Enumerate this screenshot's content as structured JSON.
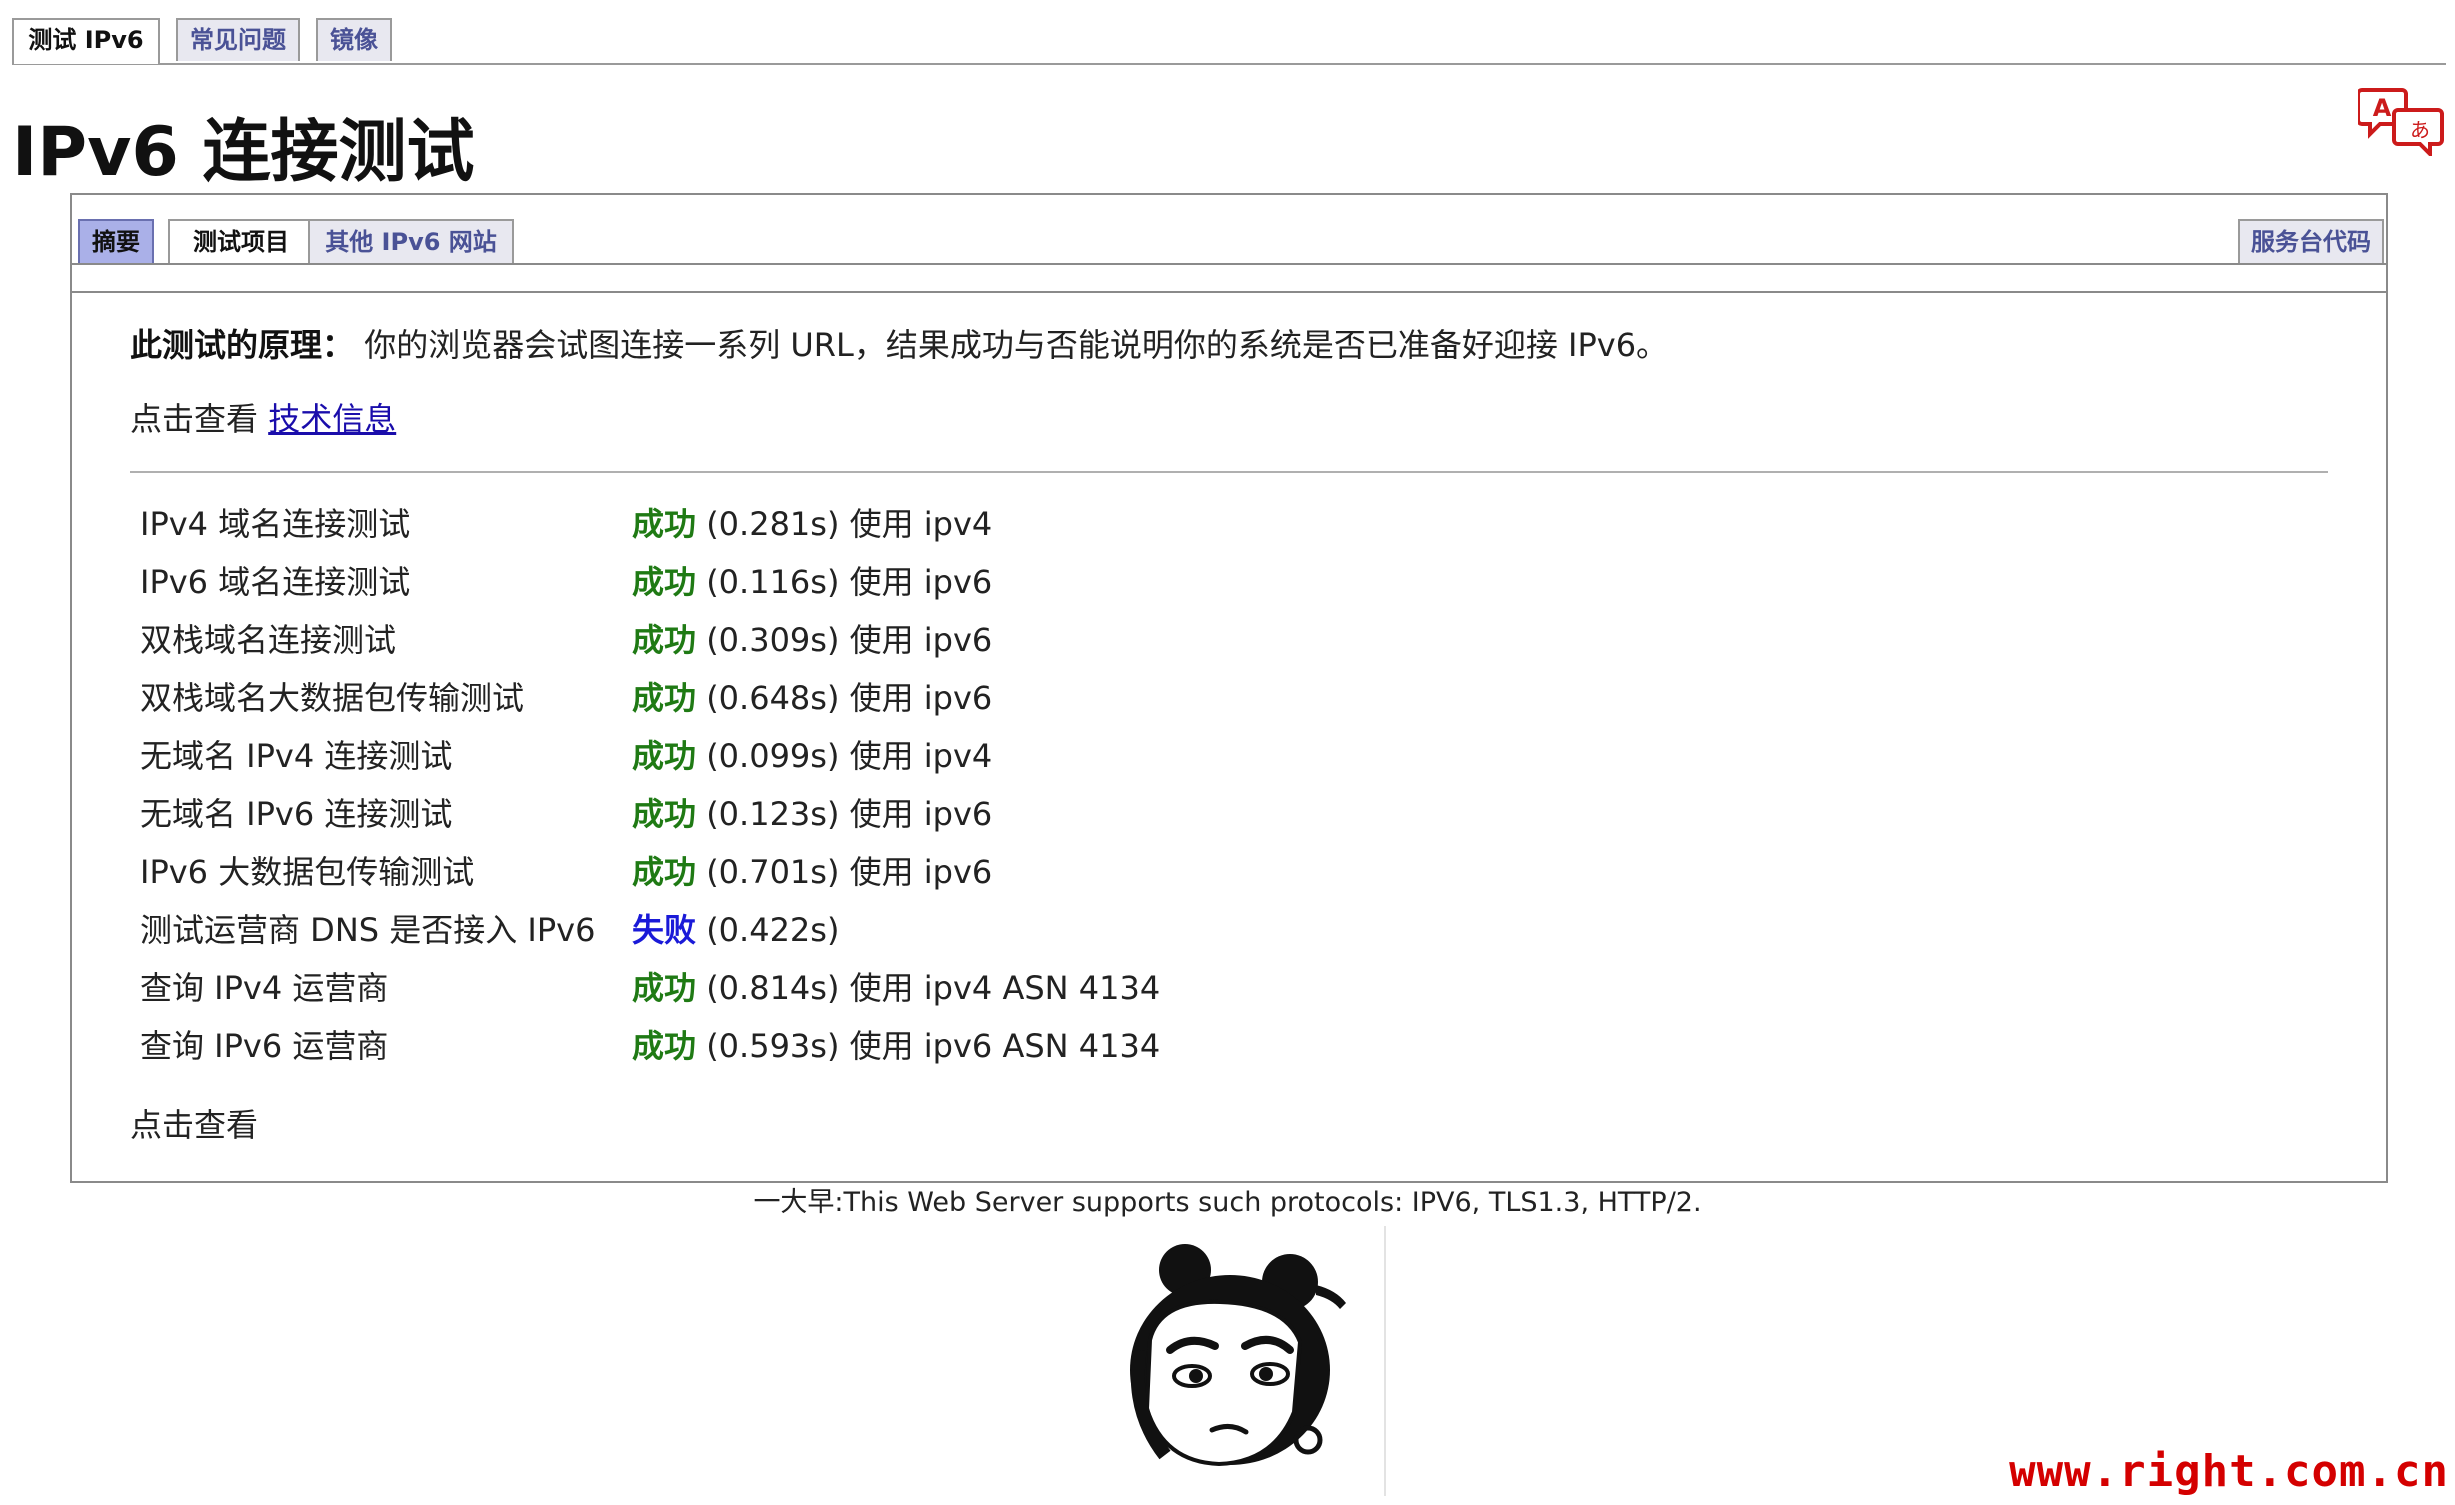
{
  "top_tabs": [
    {
      "label": "测试 IPv6",
      "active": true
    },
    {
      "label": "常见问题",
      "active": false
    },
    {
      "label": "镜像",
      "active": false
    }
  ],
  "page_title": "IPv6 连接测试",
  "sub_tabs": [
    {
      "label": "摘要",
      "state": "selected"
    },
    {
      "label": "测试项目",
      "state": "white"
    },
    {
      "label": "其他 IPv6 网站",
      "state": "normal"
    }
  ],
  "helpdesk_tab": "服务台代码",
  "intro": {
    "label": "此测试的原理：",
    "text": "你的浏览器会试图连接一系列 URL，结果成功与否能说明你的系统是否已准备好迎接 IPv6。"
  },
  "tech_info": {
    "prefix": "点击查看 ",
    "link": "技术信息"
  },
  "results": [
    {
      "name": "IPv4 域名连接测试",
      "status": "成功",
      "ok": true,
      "detail": "(0.281s) 使用 ipv4"
    },
    {
      "name": "IPv6 域名连接测试",
      "status": "成功",
      "ok": true,
      "detail": "(0.116s) 使用 ipv6"
    },
    {
      "name": "双栈域名连接测试",
      "status": "成功",
      "ok": true,
      "detail": "(0.309s) 使用 ipv6"
    },
    {
      "name": "双栈域名大数据包传输测试",
      "status": "成功",
      "ok": true,
      "detail": "(0.648s) 使用 ipv6"
    },
    {
      "name": "无域名 IPv4 连接测试",
      "status": "成功",
      "ok": true,
      "detail": "(0.099s) 使用 ipv4"
    },
    {
      "name": "无域名 IPv6 连接测试",
      "status": "成功",
      "ok": true,
      "detail": "(0.123s) 使用 ipv6"
    },
    {
      "name": "IPv6 大数据包传输测试",
      "status": "成功",
      "ok": true,
      "detail": "(0.701s) 使用 ipv6"
    },
    {
      "name": "测试运营商 DNS 是否接入 IPv6",
      "status": "失败",
      "ok": false,
      "detail": "(0.422s)"
    },
    {
      "name": "查询 IPv4 运营商",
      "status": "成功",
      "ok": true,
      "detail": "(0.814s) 使用 ipv4 ASN 4134"
    },
    {
      "name": "查询 IPv6 运营商",
      "status": "成功",
      "ok": true,
      "detail": "(0.593s) 使用 ipv6 ASN 4134"
    }
  ],
  "bottom_click": "点击查看",
  "server_note": "一大早:This Web Server supports such protocols: IPV6, TLS1.3, HTTP/2.",
  "watermark": "www.right.com.cn",
  "icons": {
    "translate": "translate-icon",
    "mascot": "cartoon-face-image"
  },
  "colors": {
    "success": "#1f7a14",
    "fail": "#1a1ad8",
    "tab_selected": "#aab0e8",
    "watermark": "#d40000"
  }
}
